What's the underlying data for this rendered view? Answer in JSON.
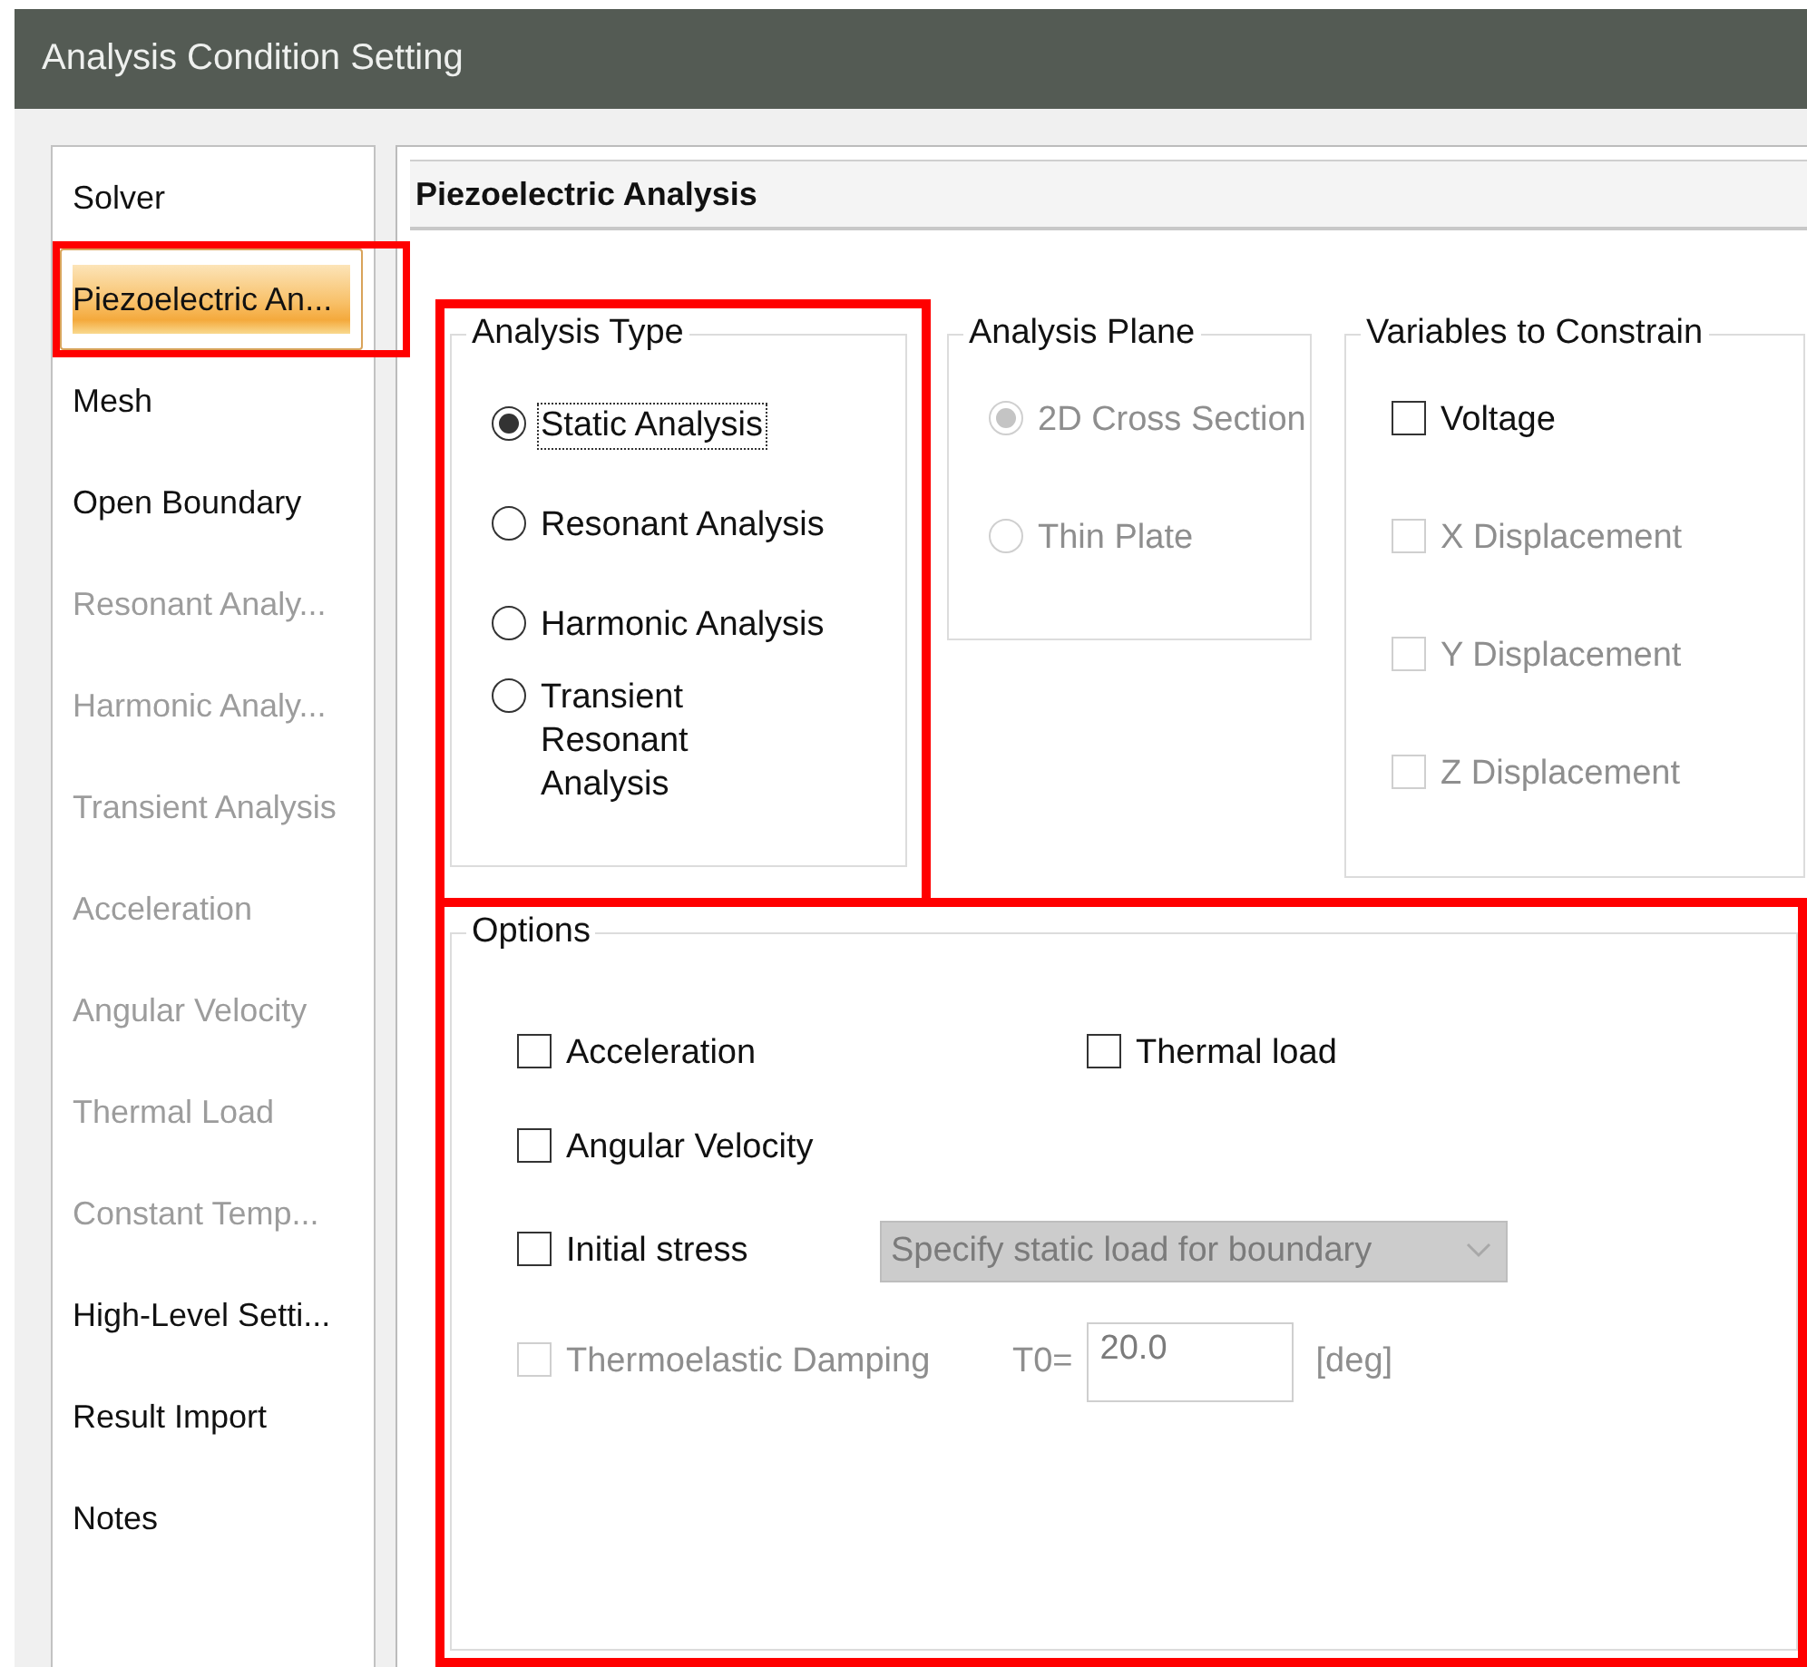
{
  "window": {
    "title": "Analysis Condition Setting"
  },
  "sidebar": {
    "items": [
      {
        "label": "Solver",
        "selected": false,
        "disabled": false,
        "highlighted": false
      },
      {
        "label": "Piezoelectric An...",
        "selected": true,
        "disabled": false,
        "highlighted": true
      },
      {
        "label": "Mesh",
        "selected": false,
        "disabled": false,
        "highlighted": false
      },
      {
        "label": "Open Boundary",
        "selected": false,
        "disabled": false,
        "highlighted": false
      },
      {
        "label": "Resonant Analy...",
        "selected": false,
        "disabled": true,
        "highlighted": false
      },
      {
        "label": "Harmonic Analy...",
        "selected": false,
        "disabled": true,
        "highlighted": false
      },
      {
        "label": "Transient Analysis",
        "selected": false,
        "disabled": true,
        "highlighted": false
      },
      {
        "label": "Acceleration",
        "selected": false,
        "disabled": true,
        "highlighted": false
      },
      {
        "label": "Angular Velocity",
        "selected": false,
        "disabled": true,
        "highlighted": false
      },
      {
        "label": "Thermal Load",
        "selected": false,
        "disabled": true,
        "highlighted": false
      },
      {
        "label": "Constant Temp...",
        "selected": false,
        "disabled": true,
        "highlighted": false
      },
      {
        "label": "High-Level Setti...",
        "selected": false,
        "disabled": false,
        "highlighted": false
      },
      {
        "label": "Result Import",
        "selected": false,
        "disabled": false,
        "highlighted": false
      },
      {
        "label": "Notes",
        "selected": false,
        "disabled": false,
        "highlighted": false
      }
    ]
  },
  "panel": {
    "title": "Piezoelectric Analysis"
  },
  "analysis_type": {
    "title": "Analysis Type",
    "highlighted": true,
    "options": [
      {
        "label": "Static Analysis",
        "selected": true,
        "disabled": false,
        "focused": true
      },
      {
        "label": "Resonant Analysis",
        "selected": false,
        "disabled": false,
        "focused": false
      },
      {
        "label": "Harmonic Analysis",
        "selected": false,
        "disabled": false,
        "focused": false
      },
      {
        "label": "Transient Resonant Analysis",
        "selected": false,
        "disabled": false,
        "focused": false
      }
    ]
  },
  "analysis_plane": {
    "title": "Analysis Plane",
    "options": [
      {
        "label": "2D Cross Section",
        "selected": true,
        "disabled": true
      },
      {
        "label": "Thin Plate",
        "selected": false,
        "disabled": true
      }
    ]
  },
  "variables_to_constrain": {
    "title": "Variables to Constrain",
    "options": [
      {
        "label": "Voltage",
        "checked": false,
        "disabled": false
      },
      {
        "label": "X Displacement",
        "checked": false,
        "disabled": true
      },
      {
        "label": "Y Displacement",
        "checked": false,
        "disabled": true
      },
      {
        "label": "Z Displacement",
        "checked": false,
        "disabled": true
      }
    ]
  },
  "options": {
    "title": "Options",
    "highlighted": true,
    "rows": [
      [
        {
          "kind": "checkbox",
          "label": "Acceleration",
          "checked": false,
          "disabled": false
        },
        {
          "kind": "checkbox",
          "label": "Thermal load",
          "checked": false,
          "disabled": false
        }
      ],
      [
        {
          "kind": "checkbox",
          "label": "Angular Velocity",
          "checked": false,
          "disabled": false
        }
      ],
      [
        {
          "kind": "checkbox",
          "label": "Initial stress",
          "checked": false,
          "disabled": false
        },
        {
          "kind": "dropdown",
          "value": "Specify static load for boundary",
          "disabled": true
        }
      ],
      [
        {
          "kind": "checkbox",
          "label": "Thermoelastic Damping",
          "checked": false,
          "disabled": true
        },
        {
          "kind": "field",
          "label": "T0=",
          "value": "20.0",
          "unit": "[deg]",
          "disabled": true
        }
      ]
    ]
  }
}
